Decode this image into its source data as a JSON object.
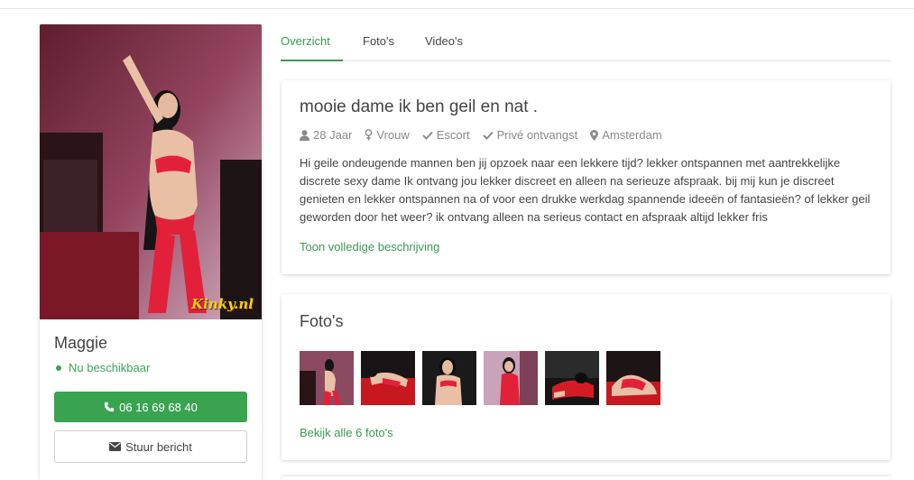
{
  "profile": {
    "name": "Maggie",
    "status": "Nu beschikbaar",
    "phone_label": "06 16 69 68 40",
    "message_label": "Stuur bericht",
    "watermark": "Kinky.nl",
    "status_color": "#3aa357",
    "button_color": "#3aa34f"
  },
  "tabs": [
    {
      "label": "Overzicht",
      "active": true
    },
    {
      "label": "Foto's",
      "active": false
    },
    {
      "label": "Video's",
      "active": false
    }
  ],
  "description": {
    "title": "mooie dame ik ben geil en nat .",
    "meta": [
      {
        "icon": "user-icon",
        "label": "28 Jaar"
      },
      {
        "icon": "gender-icon",
        "label": "Vrouw"
      },
      {
        "icon": "check-icon",
        "label": "Escort"
      },
      {
        "icon": "check-icon",
        "label": "Privé ontvangst"
      },
      {
        "icon": "map-marker-icon",
        "label": "Amsterdam"
      }
    ],
    "text": "Hi geile ondeugende mannen ben jij opzoek naar een lekkere tijd? lekker ontspannen met aantrekkelijke discrete sexy dame Ik ontvang jou lekker discreet en alleen na serieuze afspraak. bij mij kun je discreet genieten en lekker ontspannen na of voor een drukke werkdag spannende ideeën of fantasieën? of lekker geil geworden door het weer? ik ontvang alleen na serieus contact en afspraak altijd lekker fris",
    "more_link": "Toon volledige beschrijving"
  },
  "photos": {
    "title": "Foto's",
    "thumbnails": [
      "photo-1",
      "photo-2",
      "photo-3",
      "photo-4",
      "photo-5",
      "photo-6"
    ],
    "all_link": "Bekijk alle 6 foto's"
  },
  "accent_color": "#3a9a52"
}
